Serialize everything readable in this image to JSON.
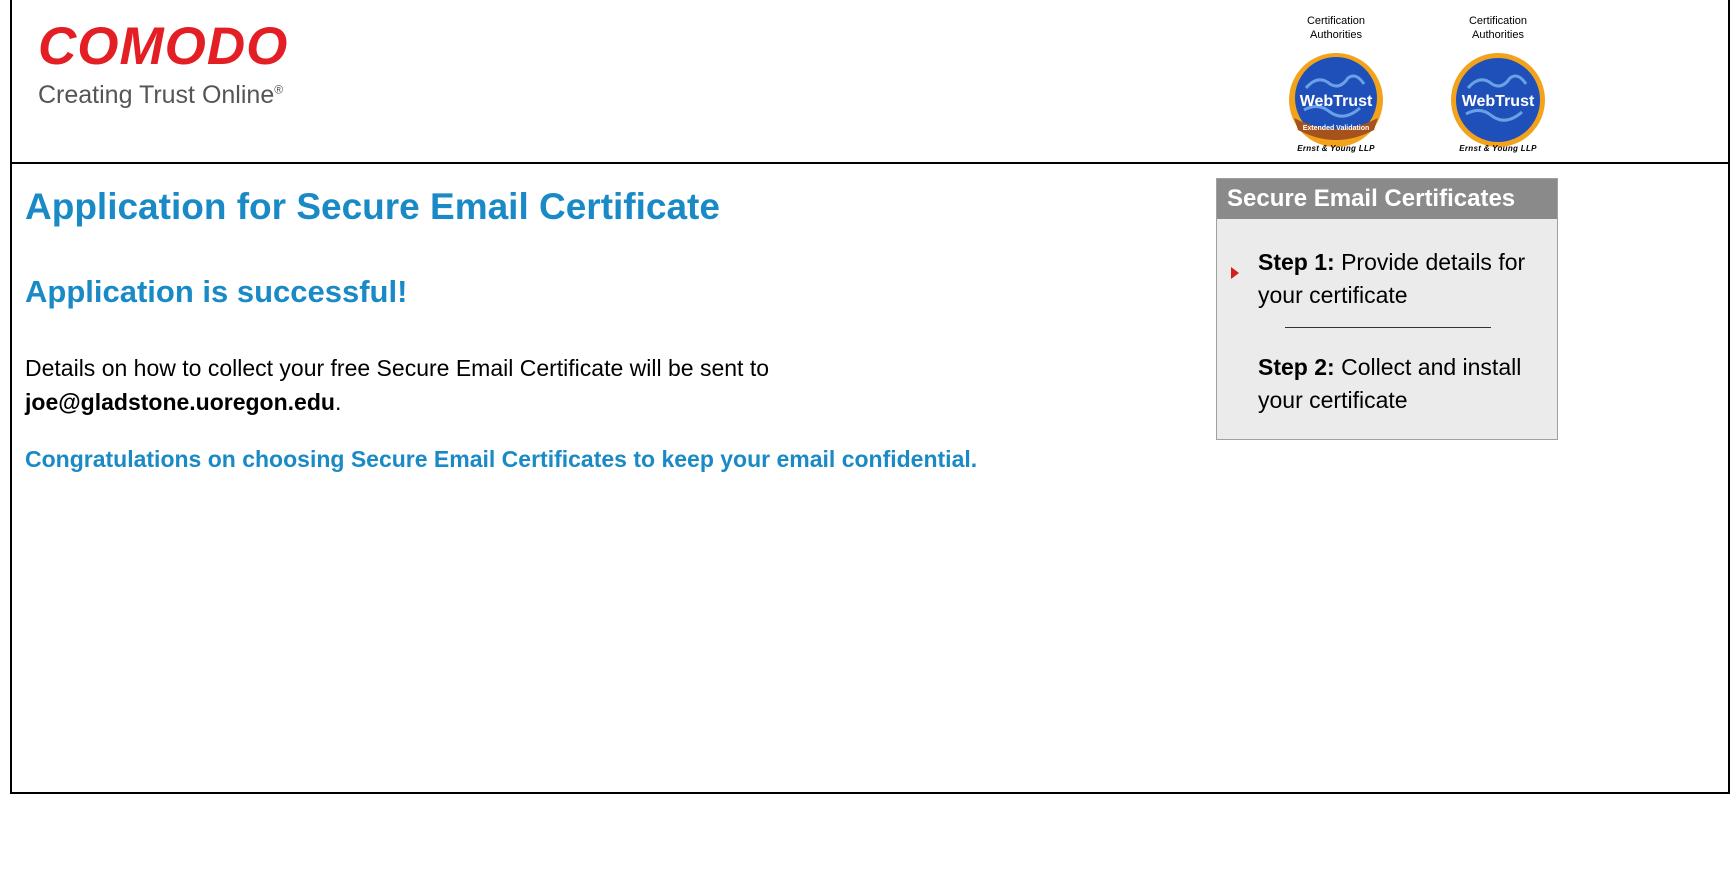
{
  "header": {
    "logo_text": "COMODO",
    "tagline": "Creating Trust Online",
    "tagline_mark": "®",
    "seals": [
      {
        "caption_line1": "Certification",
        "caption_line2": "Authorities",
        "badge_text": "WebTrust",
        "ribbon_text": "Extended Validation",
        "footer": "Ernst & Young LLP"
      },
      {
        "caption_line1": "Certification",
        "caption_line2": "Authorities",
        "badge_text": "WebTrust",
        "footer": "Ernst & Young LLP"
      }
    ]
  },
  "main": {
    "title": "Application for Secure Email Certificate",
    "success_heading": "Application is successful!",
    "details_prefix": "Details on how to collect your free Secure Email Certificate will be sent to",
    "email": "joe@gladstone.uoregon.edu",
    "details_suffix": ".",
    "congrats": "Congratulations on choosing Secure Email Certificates to keep your email confidential."
  },
  "sidebar": {
    "header": "Secure Email Certificates",
    "steps": [
      {
        "label": "Step 1:",
        "text": "Provide details for your certificate",
        "active": true
      },
      {
        "label": "Step 2:",
        "text": "Collect and install your certificate",
        "active": false
      }
    ]
  },
  "colors": {
    "brand_red": "#e31e24",
    "heading_blue": "#1a8ac6",
    "panel_gray": "#ebebeb",
    "panel_header": "#8a8a8a"
  }
}
